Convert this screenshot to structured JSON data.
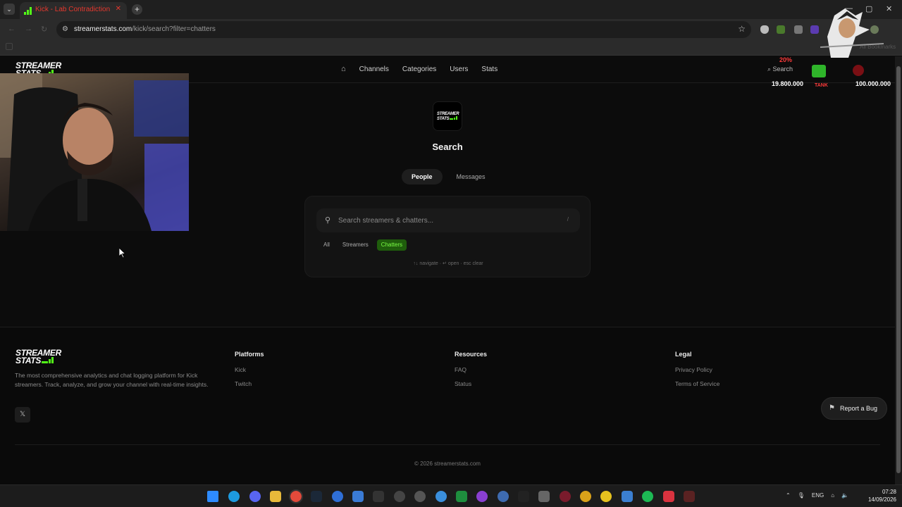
{
  "browser": {
    "tab_title": "Kick - Lab Contradiction",
    "tab_close": "✕",
    "new_tab": "+",
    "url_host": "streamerstats.com",
    "url_path": "/kick/search?filter=chatters",
    "bookmarks_label": "All Bookmarks",
    "window_controls": [
      "—",
      "▢",
      "✕"
    ]
  },
  "header": {
    "logo_line1": "STREAMER",
    "logo_line2": "STATS",
    "nav": [
      "Channels",
      "Categories",
      "Users",
      "Stats"
    ],
    "search_label": "Search"
  },
  "search": {
    "title": "Search",
    "modes": [
      "People",
      "Messages"
    ],
    "active_mode": "People",
    "placeholder": "Search streamers & chatters...",
    "slash_hint": "/",
    "filters": [
      "All",
      "Streamers",
      "Chatters"
    ],
    "active_filter": "Chatters",
    "shortcuts": "↑↓ navigate · ↵ open · esc clear"
  },
  "footer": {
    "description": "The most comprehensive analytics and chat logging platform for Kick streamers. Track, analyze, and grow your channel with real-time insights.",
    "social_x": "𝕏",
    "columns": [
      {
        "title": "Platforms",
        "links": [
          "Kick",
          "Twitch"
        ]
      },
      {
        "title": "Resources",
        "links": [
          "FAQ",
          "Status"
        ]
      },
      {
        "title": "Legal",
        "links": [
          "Privacy Policy",
          "Terms of Service"
        ]
      }
    ],
    "copyright": "© 2026 streamerstats.com"
  },
  "report_bug": "Report a Bug",
  "overlay": {
    "percent": "20%",
    "left_value": "19.800.000",
    "right_value": "100.000.000",
    "tank_label": "TANK"
  },
  "taskbar": {
    "lang": "ENG",
    "time": "07:28",
    "date": "14/09/2026"
  },
  "colors": {
    "accent": "#53fc18",
    "background": "#0c0c0c",
    "active_chip_bg": "#1f5d0c"
  }
}
